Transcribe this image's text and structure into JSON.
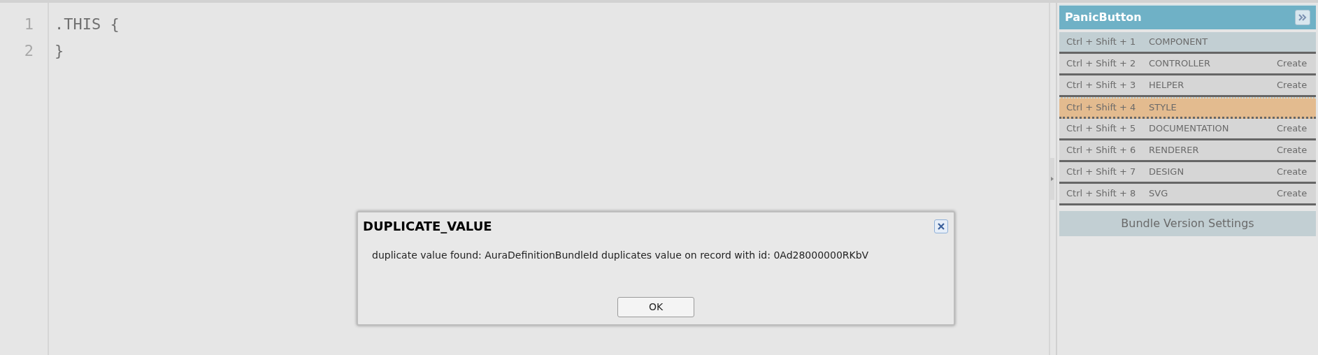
{
  "editor": {
    "lines": [
      {
        "number": "1",
        "code": ".THIS {"
      },
      {
        "number": "2",
        "code": "}"
      }
    ]
  },
  "panel": {
    "title": "PanicButton",
    "items": [
      {
        "shortcut": "Ctrl + Shift + 1",
        "name": "COMPONENT",
        "selected": false,
        "hovered": true
      },
      {
        "shortcut": "Ctrl + Shift + 2",
        "name": "CONTROLLER",
        "action": "Create",
        "selected": false,
        "hovered": false
      },
      {
        "shortcut": "Ctrl + Shift + 3",
        "name": "HELPER",
        "action": "Create",
        "selected": false,
        "hovered": false
      },
      {
        "shortcut": "Ctrl + Shift + 4",
        "name": "STYLE",
        "selected": true,
        "hovered": false
      },
      {
        "shortcut": "Ctrl + Shift + 5",
        "name": "DOCUMENTATION",
        "action": "Create",
        "selected": false,
        "hovered": false
      },
      {
        "shortcut": "Ctrl + Shift + 6",
        "name": "RENDERER",
        "action": "Create",
        "selected": false,
        "hovered": false
      },
      {
        "shortcut": "Ctrl + Shift + 7",
        "name": "DESIGN",
        "action": "Create",
        "selected": false,
        "hovered": false
      },
      {
        "shortcut": "Ctrl + Shift + 8",
        "name": "SVG",
        "action": "Create",
        "selected": false,
        "hovered": false
      }
    ],
    "settings_button": "Bundle Version Settings"
  },
  "dialog": {
    "title": "DUPLICATE_VALUE",
    "message": "duplicate value found: AuraDefinitionBundleId duplicates value on record with id: 0Ad28000000RKbV",
    "button": "OK"
  }
}
